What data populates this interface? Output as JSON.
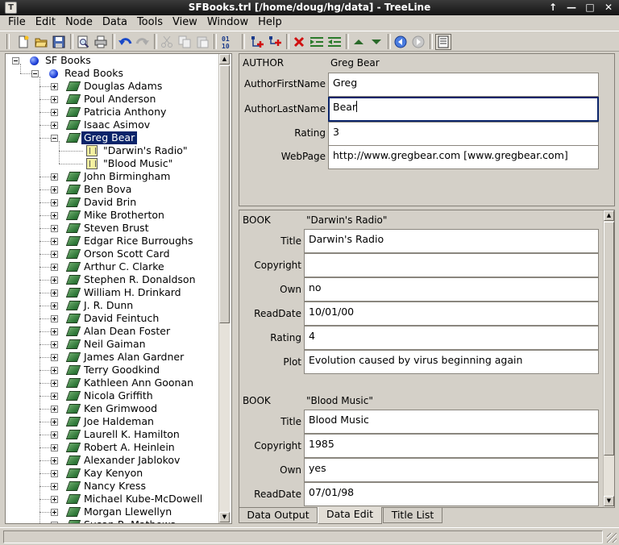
{
  "window": {
    "title": "SFBooks.trl [/home/doug/hg/data] - TreeLine",
    "app_icon_glyph": "T",
    "buttons": [
      "↑",
      "—",
      "□",
      "✕"
    ]
  },
  "menu": [
    "File",
    "Edit",
    "Node",
    "Data",
    "Tools",
    "View",
    "Window",
    "Help"
  ],
  "tree": {
    "root": "SF Books",
    "group": "Read Books",
    "authors_before": [
      "Douglas Adams",
      "Poul Anderson",
      "Patricia Anthony",
      "Isaac Asimov"
    ],
    "selected": "Greg Bear",
    "selected_books": [
      "\"Darwin's Radio\"",
      "\"Blood Music\""
    ],
    "authors_after": [
      "John Birmingham",
      "Ben Bova",
      "David Brin",
      "Mike Brotherton",
      "Steven Brust",
      "Edgar Rice Burroughs",
      "Orson Scott Card",
      "Arthur C. Clarke",
      "Stephen R. Donaldson",
      "William H. Drinkard",
      "J. R. Dunn",
      "David Feintuch",
      "Alan Dean Foster",
      "Neil Gaiman",
      "James Alan Gardner",
      "Terry Goodkind",
      "Kathleen Ann Goonan",
      "Nicola Griffith",
      "Ken Grimwood",
      "Joe Haldeman",
      "Laurell K. Hamilton",
      "Robert A. Heinlein",
      "Alexander Jablokov",
      "Kay Kenyon",
      "Nancy Kress",
      "Michael Kube-McDowell",
      "Morgan Llewellyn",
      "Susan R. Mathews"
    ]
  },
  "author_record": {
    "type": "AUTHOR",
    "name": "Greg Bear",
    "fields": [
      {
        "label": "AuthorFirstName",
        "value": "Greg"
      },
      {
        "label": "AuthorLastName",
        "value": "Bear"
      },
      {
        "label": "Rating",
        "value": "3"
      },
      {
        "label": "WebPage",
        "value": "http://www.gregbear.com [www.gregbear.com]"
      }
    ]
  },
  "book_records": [
    {
      "type": "BOOK",
      "name": "\"Darwin's Radio\"",
      "fields": [
        {
          "label": "Title",
          "value": "Darwin's Radio"
        },
        {
          "label": "Copyright",
          "value": ""
        },
        {
          "label": "Own",
          "value": "no"
        },
        {
          "label": "ReadDate",
          "value": "10/01/00"
        },
        {
          "label": "Rating",
          "value": "4"
        },
        {
          "label": "Plot",
          "value": "Evolution caused by virus beginning again"
        }
      ]
    },
    {
      "type": "BOOK",
      "name": "\"Blood Music\"",
      "fields": [
        {
          "label": "Title",
          "value": "Blood Music"
        },
        {
          "label": "Copyright",
          "value": "1985"
        },
        {
          "label": "Own",
          "value": "yes"
        },
        {
          "label": "ReadDate",
          "value": "07/01/98"
        }
      ]
    }
  ],
  "tabs": [
    "Data Output",
    "Data Edit",
    "Title List"
  ],
  "active_tab": "Data Edit",
  "toolbar_icons": [
    "new-file-icon",
    "open-folder-icon",
    "save-icon",
    "print-preview-icon",
    "print-icon",
    "undo-icon",
    "redo-icon",
    "cut-icon",
    "copy-icon",
    "paste-icon",
    "numbering-icon",
    "add-child-icon",
    "insert-after-icon",
    "delete-node-icon",
    "indent-icon",
    "unindent-icon",
    "move-up-icon",
    "move-down-icon",
    "back-icon",
    "forward-icon",
    "toggle-panel-icon"
  ]
}
